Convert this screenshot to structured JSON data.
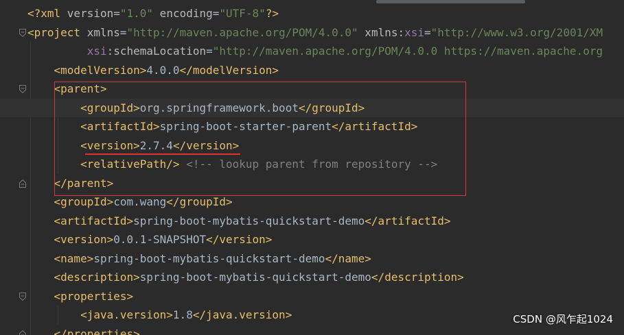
{
  "editor": {
    "lines": [
      {
        "segments": [
          {
            "text": "<?xml ",
            "cls": "t-tag"
          },
          {
            "text": "version",
            "cls": "t-attr"
          },
          {
            "text": "=",
            "cls": "t-punct"
          },
          {
            "text": "\"1.0\"",
            "cls": "t-val"
          },
          {
            "text": " encoding",
            "cls": "t-attr"
          },
          {
            "text": "=",
            "cls": "t-punct"
          },
          {
            "text": "\"UTF-8\"",
            "cls": "t-val"
          },
          {
            "text": "?>",
            "cls": "t-tag"
          }
        ]
      },
      {
        "segments": [
          {
            "text": "<project ",
            "cls": "t-tag"
          },
          {
            "text": "xmlns",
            "cls": "t-attr"
          },
          {
            "text": "=",
            "cls": "t-punct"
          },
          {
            "text": "\"http://maven.apache.org/POM/4.0.0\"",
            "cls": "t-val"
          },
          {
            "text": " xmlns:",
            "cls": "t-attr"
          },
          {
            "text": "xsi",
            "cls": "t-ns"
          },
          {
            "text": "=",
            "cls": "t-punct"
          },
          {
            "text": "\"http://www.w3.org/2001/XM",
            "cls": "t-val"
          }
        ]
      },
      {
        "segments": [
          {
            "text": "         ",
            "cls": "t-text"
          },
          {
            "text": "xsi",
            "cls": "t-ns"
          },
          {
            "text": ":schemaLocation",
            "cls": "t-attr"
          },
          {
            "text": "=",
            "cls": "t-punct"
          },
          {
            "text": "\"http://maven.apache.org/POM/4.0.0 https://maven.apache.org",
            "cls": "t-val"
          }
        ]
      },
      {
        "segments": [
          {
            "text": "    ",
            "cls": "t-text"
          },
          {
            "text": "<modelVersion>",
            "cls": "t-tag"
          },
          {
            "text": "4.0.0",
            "cls": "t-text"
          },
          {
            "text": "</modelVersion>",
            "cls": "t-tag"
          }
        ]
      },
      {
        "segments": [
          {
            "text": "    ",
            "cls": "t-text"
          },
          {
            "text": "<parent>",
            "cls": "t-tag"
          }
        ]
      },
      {
        "segments": [
          {
            "text": "        ",
            "cls": "t-text"
          },
          {
            "text": "<groupId>",
            "cls": "t-tag"
          },
          {
            "text": "org.springframework.boot",
            "cls": "t-text"
          },
          {
            "text": "</groupId>",
            "cls": "t-tag"
          }
        ]
      },
      {
        "segments": [
          {
            "text": "        ",
            "cls": "t-text"
          },
          {
            "text": "<artifactId>",
            "cls": "t-tag"
          },
          {
            "text": "spring-boot-starter-parent",
            "cls": "t-text"
          },
          {
            "text": "</artifactId>",
            "cls": "t-tag"
          }
        ]
      },
      {
        "segments": [
          {
            "text": "        ",
            "cls": "t-text"
          },
          {
            "text": "<version>",
            "cls": "t-tag"
          },
          {
            "text": "2.7.4",
            "cls": "t-text"
          },
          {
            "text": "</version>",
            "cls": "t-tag"
          }
        ]
      },
      {
        "segments": [
          {
            "text": "        ",
            "cls": "t-text"
          },
          {
            "text": "<relativePath/>",
            "cls": "t-tag"
          },
          {
            "text": " <!-- lookup parent from repository -->",
            "cls": "t-comment"
          }
        ]
      },
      {
        "segments": [
          {
            "text": "    ",
            "cls": "t-text"
          },
          {
            "text": "</parent>",
            "cls": "t-tag"
          }
        ]
      },
      {
        "segments": [
          {
            "text": "    ",
            "cls": "t-text"
          },
          {
            "text": "<groupId>",
            "cls": "t-tag"
          },
          {
            "text": "com.wang",
            "cls": "t-text"
          },
          {
            "text": "</groupId>",
            "cls": "t-tag"
          }
        ]
      },
      {
        "segments": [
          {
            "text": "    ",
            "cls": "t-text"
          },
          {
            "text": "<artifactId>",
            "cls": "t-tag"
          },
          {
            "text": "spring-boot-mybatis-quickstart-demo",
            "cls": "t-text"
          },
          {
            "text": "</artifactId>",
            "cls": "t-tag"
          }
        ]
      },
      {
        "segments": [
          {
            "text": "    ",
            "cls": "t-text"
          },
          {
            "text": "<version>",
            "cls": "t-tag"
          },
          {
            "text": "0.0.1-SNAPSHOT",
            "cls": "t-text"
          },
          {
            "text": "</version>",
            "cls": "t-tag"
          }
        ]
      },
      {
        "segments": [
          {
            "text": "    ",
            "cls": "t-text"
          },
          {
            "text": "<name>",
            "cls": "t-tag"
          },
          {
            "text": "spring-boot-mybatis-quickstart-demo",
            "cls": "t-text"
          },
          {
            "text": "</name>",
            "cls": "t-tag"
          }
        ]
      },
      {
        "segments": [
          {
            "text": "    ",
            "cls": "t-text"
          },
          {
            "text": "<description>",
            "cls": "t-tag"
          },
          {
            "text": "spring-boot-mybatis-quickstart-demo",
            "cls": "t-text"
          },
          {
            "text": "</description>",
            "cls": "t-tag"
          }
        ]
      },
      {
        "segments": [
          {
            "text": "    ",
            "cls": "t-text"
          },
          {
            "text": "<properties>",
            "cls": "t-tag"
          }
        ]
      },
      {
        "segments": [
          {
            "text": "        ",
            "cls": "t-text"
          },
          {
            "text": "<java.version>",
            "cls": "t-tag"
          },
          {
            "text": "1.8",
            "cls": "t-text"
          },
          {
            "text": "</java.version>",
            "cls": "t-tag"
          }
        ]
      },
      {
        "segments": [
          {
            "text": "    ",
            "cls": "t-text"
          },
          {
            "text": "</properties>",
            "cls": "t-tag"
          }
        ]
      }
    ],
    "current_line_index": 5,
    "fold_markers": [
      {
        "line": 1,
        "icon": "fold-open-icon"
      },
      {
        "line": 4,
        "icon": "fold-open-icon"
      },
      {
        "line": 9,
        "icon": "fold-close-icon"
      },
      {
        "line": 15,
        "icon": "fold-open-icon"
      },
      {
        "line": 17,
        "icon": "fold-close-icon"
      }
    ]
  },
  "colors": {
    "background": "#2b2b2b",
    "tag": "#e8bf6a",
    "attribute_value": "#6a8759",
    "namespace": "#9876aa",
    "text": "#a9b7c6",
    "comment": "#808080",
    "annotation": "#d9383a"
  },
  "watermark": {
    "text": "CSDN @风乍起1024"
  }
}
